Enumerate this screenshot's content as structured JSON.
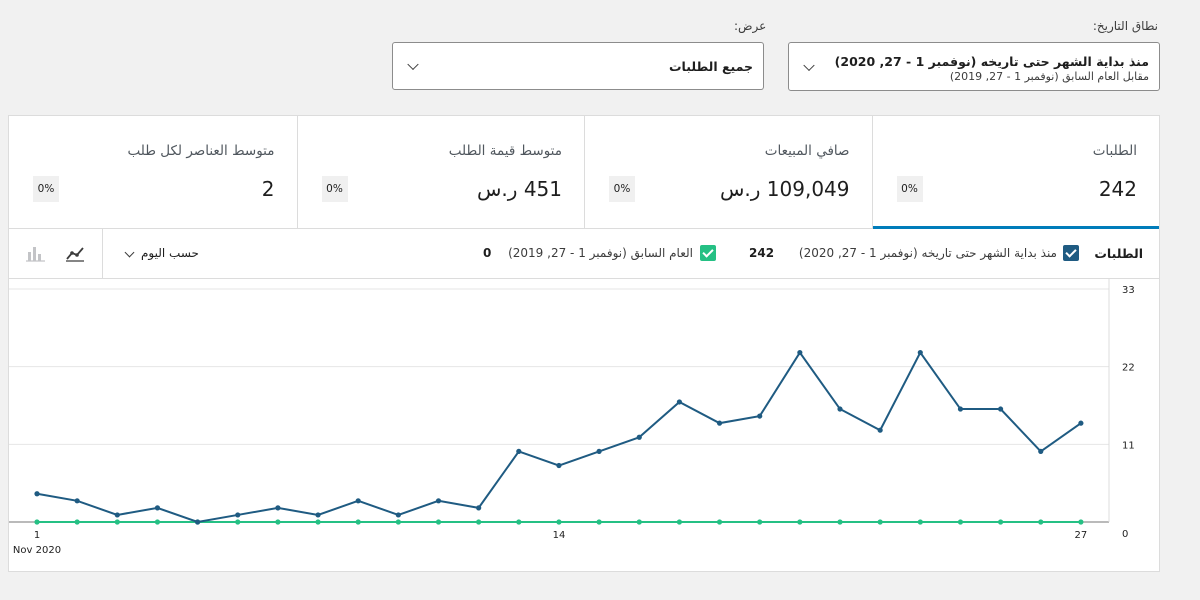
{
  "filters": {
    "date_range": {
      "label": "نطاق التاريخ:",
      "value": "منذ بداية الشهر حتى تاريخه (نوفمبر 1 - 27, 2020)",
      "compare": "مقابل العام السابق (نوفمبر 1 - 27, 2019)"
    },
    "show": {
      "label": "عرض:",
      "value": "جميع الطلبات"
    }
  },
  "summary": [
    {
      "label": "الطلبات",
      "value": "242",
      "delta": "0%"
    },
    {
      "label": "صافي المبيعات",
      "value": "109,049 ر.س",
      "delta": "0%"
    },
    {
      "label": "متوسط قيمة الطلب",
      "value": "451 ر.س",
      "delta": "0%"
    },
    {
      "label": "متوسط العناصر لكل طلب",
      "value": "2",
      "delta": "0%"
    }
  ],
  "chart_header": {
    "title": "الطلبات",
    "current_label": "منذ بداية الشهر حتى تاريخه (نوفمبر 1 - 27, 2020)",
    "current_total": "242",
    "previous_label": "العام السابق (نوفمبر 1 - 27, 2019)",
    "previous_total": "0",
    "interval": "حسب اليوم"
  },
  "colors": {
    "current": "#1f5b82",
    "previous": "#25c084",
    "active_tab": "#007cba"
  },
  "icons": {
    "line_chart": "line-chart-icon",
    "bar_chart": "bar-chart-icon"
  },
  "chart_data": {
    "type": "line",
    "x": [
      1,
      2,
      3,
      4,
      5,
      6,
      7,
      8,
      9,
      10,
      11,
      12,
      13,
      14,
      15,
      16,
      17,
      18,
      19,
      20,
      21,
      22,
      23,
      24,
      25,
      26,
      27
    ],
    "x_ticks": [
      "1",
      "14",
      "27"
    ],
    "x_sublabel": "Nov 2020",
    "y_ticks": [
      "0",
      "11",
      "22",
      "33"
    ],
    "ylim": [
      0,
      33
    ],
    "grid": true,
    "series": [
      {
        "name": "منذ بداية الشهر حتى تاريخه (نوفمبر 1 - 27, 2020)",
        "color": "#1f5b82",
        "values": [
          4,
          3,
          1,
          2,
          0,
          1,
          2,
          1,
          3,
          1,
          3,
          2,
          10,
          8,
          10,
          12,
          17,
          14,
          15,
          24,
          16,
          13,
          24,
          16,
          16,
          10,
          14
        ]
      },
      {
        "name": "العام السابق (نوفمبر 1 - 27, 2019)",
        "color": "#25c084",
        "values": [
          0,
          0,
          0,
          0,
          0,
          0,
          0,
          0,
          0,
          0,
          0,
          0,
          0,
          0,
          0,
          0,
          0,
          0,
          0,
          0,
          0,
          0,
          0,
          0,
          0,
          0,
          0
        ]
      }
    ]
  }
}
